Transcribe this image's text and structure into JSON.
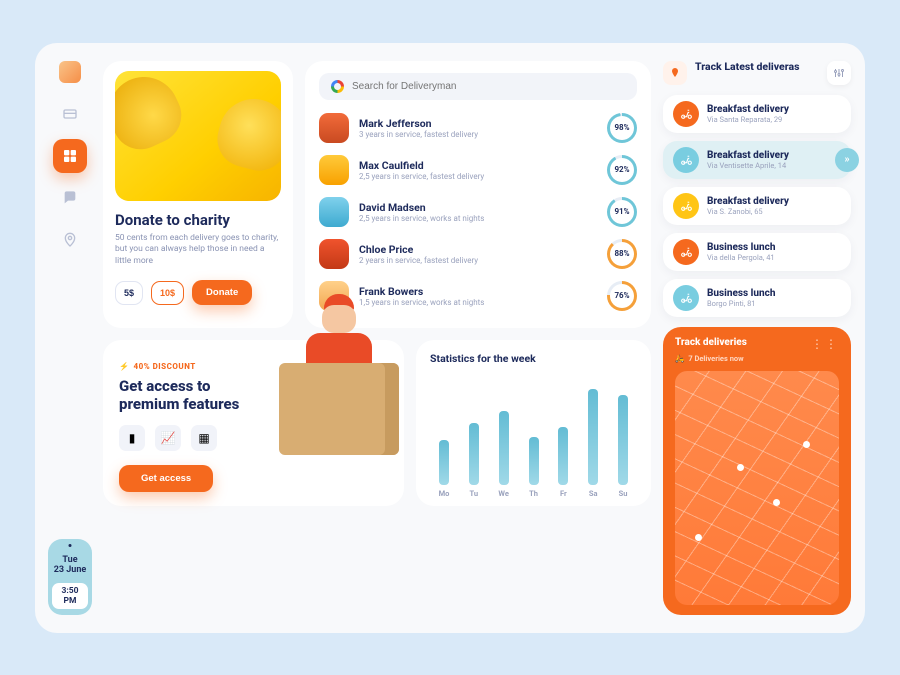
{
  "sidebar": {
    "day": "Tue",
    "date": "23 June",
    "time": "3:50 PM"
  },
  "donate": {
    "title": "Donate to charity",
    "blurb": "50 cents from each delivery goes to charity, but you can always help those in need a little more",
    "amount_a": "5$",
    "amount_b": "10$",
    "cta": "Donate"
  },
  "search": {
    "placeholder": "Search for Deliveryman"
  },
  "people": [
    {
      "name": "Mark Jefferson",
      "meta": "3 years in service, fastest delivery",
      "pct": "98%",
      "pv": 98,
      "col": "#6fc6d8"
    },
    {
      "name": "Max Caulfield",
      "meta": "2,5 years in service, fastest delivery",
      "pct": "92%",
      "pv": 92,
      "col": "#6fc6d8"
    },
    {
      "name": "David Madsen",
      "meta": "2,5 years in service, works at nights",
      "pct": "91%",
      "pv": 91,
      "col": "#6fc6d8"
    },
    {
      "name": "Chloe Price",
      "meta": "2 years in service, fastest delivery",
      "pct": "88%",
      "pv": 88,
      "col": "#f5a03a"
    },
    {
      "name": "Frank Bowers",
      "meta": "1,5 years in service, works at nights",
      "pct": "76%",
      "pv": 76,
      "col": "#f5a03a"
    }
  ],
  "premium": {
    "badge": "40% DISCOUNT",
    "heading_a": "Get access to",
    "heading_b": "premium features",
    "cta": "Get access"
  },
  "stats": {
    "title": "Statistics for the week"
  },
  "chart_data": {
    "type": "bar",
    "categories": [
      "Mo",
      "Tu",
      "We",
      "Th",
      "Fr",
      "Sa",
      "Su"
    ],
    "values": [
      45,
      62,
      74,
      48,
      58,
      96,
      90
    ],
    "ylim": [
      0,
      100
    ],
    "title": "Statistics for the week"
  },
  "track": {
    "title": "Track Latest deliveras"
  },
  "deliveries": [
    {
      "title": "Breakfast delivery",
      "addr": "Via Santa Reparata, 29",
      "tone": "or"
    },
    {
      "title": "Breakfast delivery",
      "addr": "Via Ventisette Aprile, 14",
      "tone": "cy",
      "active": true
    },
    {
      "title": "Breakfast delivery",
      "addr": "Via S. Zanobi, 65",
      "tone": "ye"
    },
    {
      "title": "Business lunch",
      "addr": "Via della Pergola, 41",
      "tone": "or"
    },
    {
      "title": "Business lunch",
      "addr": "Borgo Pinti, 81",
      "tone": "cy"
    }
  ],
  "map": {
    "title": "Track deliveries",
    "subtitle": "7 Deliveries now"
  }
}
